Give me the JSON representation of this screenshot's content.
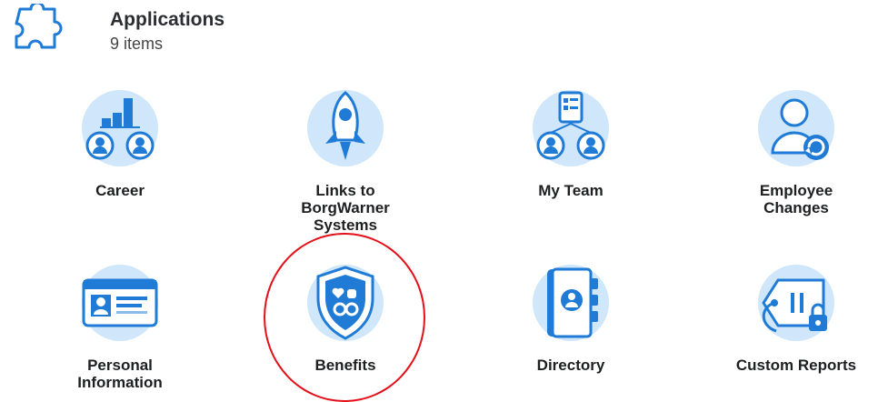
{
  "header": {
    "title": "Applications",
    "count": "9 items",
    "icon": "puzzle-icon"
  },
  "tiles": [
    {
      "id": "career",
      "label": "Career",
      "icon": "career-icon"
    },
    {
      "id": "links",
      "label": "Links to BorgWarner Systems",
      "label_lines": [
        "Links to",
        "BorgWarner",
        "Systems"
      ],
      "icon": "rocket-icon"
    },
    {
      "id": "team",
      "label": "My Team",
      "icon": "team-icon"
    },
    {
      "id": "changes",
      "label": "Employee Changes",
      "label_lines": [
        "Employee",
        "Changes"
      ],
      "icon": "employee-changes-icon"
    },
    {
      "id": "personal",
      "label": "Personal Information",
      "label_lines": [
        "Personal",
        "Information"
      ],
      "icon": "id-card-icon"
    },
    {
      "id": "benefits",
      "label": "Benefits",
      "icon": "shield-icon",
      "highlighted": true
    },
    {
      "id": "directory",
      "label": "Directory",
      "icon": "directory-book-icon"
    },
    {
      "id": "reports",
      "label": "Custom Reports",
      "icon": "tag-lock-icon"
    }
  ],
  "colors": {
    "accent": "#1f7bd6",
    "light": "#cfe6fb",
    "circle": "#e3101a"
  }
}
